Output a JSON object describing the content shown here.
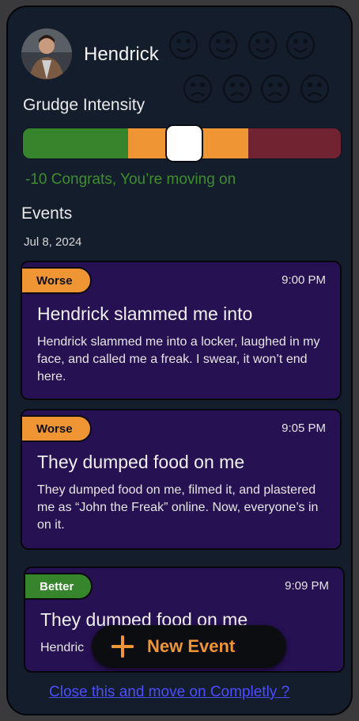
{
  "profile": {
    "name": "Hendrick"
  },
  "grudge": {
    "title": "Grudge Intensity",
    "score_text": "-10 Congrats, You’re moving on",
    "colors": {
      "low": "#36842b",
      "mid": "#ef9533",
      "high": "#712331"
    }
  },
  "events": {
    "title": "Events",
    "date": "Jul 8, 2024",
    "items": [
      {
        "badge": "Worse",
        "time": "9:00 PM",
        "title": "Hendrick slammed me into",
        "body": "Hendrick slammed me into a locker, laughed in my face, and called me a freak. I swear, it won’t end here."
      },
      {
        "badge": "Worse",
        "time": "9:05 PM",
        "title": "They dumped food on me",
        "body": "They dumped food on me, filmed it, and plastered me as “John the Freak” online. Now, everyone’s in on it."
      },
      {
        "badge": "Better",
        "time": "9:09 PM",
        "title": "They dumped food on me",
        "body": "Hendric"
      }
    ]
  },
  "actions": {
    "new_event_label": "New Event",
    "close_link": "Close this and move on Completly ?"
  },
  "icons": {
    "mood_icons": [
      "smile-icon",
      "sad-icon"
    ],
    "add": "plus-icon"
  }
}
